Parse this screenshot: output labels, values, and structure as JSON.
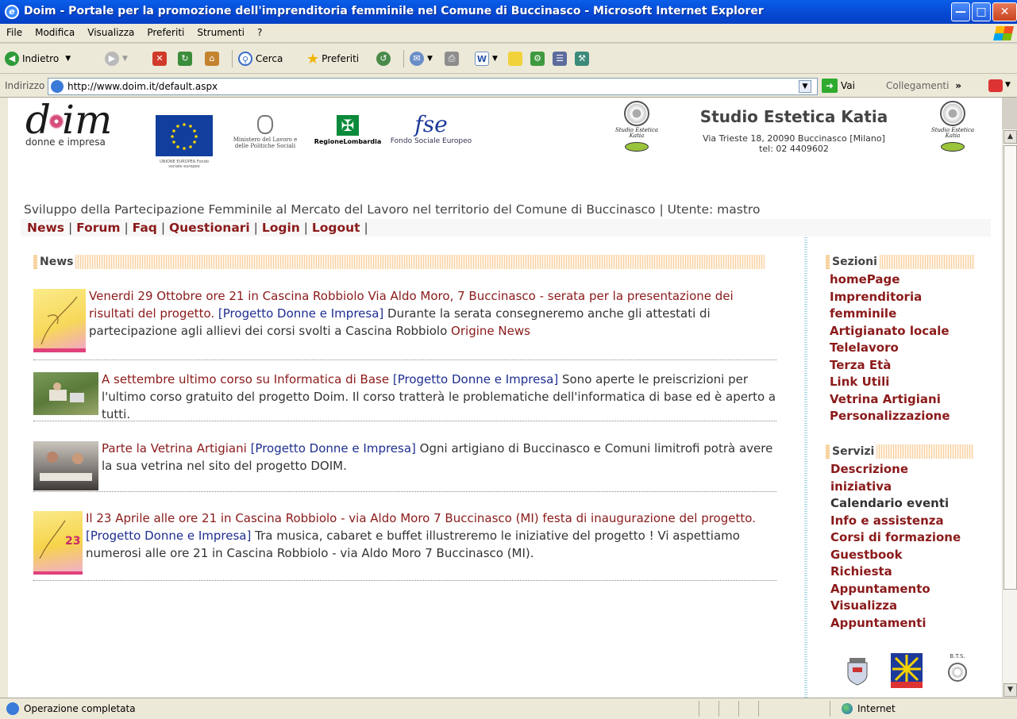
{
  "window": {
    "title": "Doim - Portale per la promozione dell'imprenditoria femminile nel Comune di Buccinasco - Microsoft Internet Explorer"
  },
  "menu": [
    "File",
    "Modifica",
    "Visualizza",
    "Preferiti",
    "Strumenti",
    "?"
  ],
  "toolbar": {
    "back": "Indietro",
    "search": "Cerca",
    "favorites": "Preferiti"
  },
  "address": {
    "label": "Indirizzo",
    "url": "http://www.doim.it/default.aspx",
    "go": "Vai",
    "links": "Collegamenti"
  },
  "header": {
    "logo_subtitle": "donne e impresa",
    "logo_letters": [
      "d",
      "im"
    ],
    "eu_caption": "UNIONE EUROPEA Fondo sociale europeo",
    "ministry": "Ministero del Lavoro e delle Politiche Sociali",
    "region": "RegioneLombardia",
    "fse": "Fondo Sociale Europeo",
    "fse_word": "fse",
    "studio_title": "Studio Estetica Katia",
    "studio_address": "Via Trieste 18, 20090 Buccinasco [Milano]",
    "studio_tel": "tel: 02 4409602",
    "studio_script": "Studio Estetica Katia"
  },
  "tagline": "Sviluppo della Partecipazione Femminile al Mercato del Lavoro nel territorio del Comune di Buccinasco",
  "user": "| Utente: mastro",
  "nav": [
    "News",
    "Forum",
    "Faq",
    "Questionari",
    "Login",
    "Logout"
  ],
  "news_heading": "News",
  "news": [
    {
      "title": "Venerdi 29 Ottobre ore 21 in Cascina Robbiolo Via Aldo Moro, 7 Buccinasco - serata per la presentazione dei risultati del progetto.",
      "tag": "[Progetto Donne e Impresa]",
      "body": "Durante la serata consegneremo anche gli attestati di partecipazione agli allievi dei corsi svolti a Cascina Robbiolo",
      "origin": "Origine News"
    },
    {
      "title": "A settembre ultimo corso su Informatica di Base",
      "tag": "[Progetto Donne e Impresa]",
      "body": "Sono aperte le preiscrizioni per l'ultimo corso gratuito del progetto Doim. Il corso tratterà le problematiche dell'informatica di base ed è aperto a tutti.",
      "origin": ""
    },
    {
      "title": "Parte la Vetrina Artigiani",
      "tag": "[Progetto Donne e Impresa]",
      "body": "Ogni artigiano di Buccinasco e Comuni limitrofi potrà avere la sua vetrina nel sito del progetto DOIM.",
      "origin": ""
    },
    {
      "title": "Il 23 Aprile alle ore 21 in Cascina Robbiolo - via Aldo Moro 7 Buccinasco (MI) festa di inaugurazione del progetto.",
      "tag": "[Progetto Donne e Impresa]",
      "body": "Tra musica, cabaret e buffet illustreremo le iniziative del progetto ! Vi aspettiamo numerosi alle ore 21 in Cascina Robbiolo - via Aldo Moro 7 Buccinasco (MI).",
      "origin": ""
    }
  ],
  "sections_heading": "Sezioni",
  "sections": [
    "homePage",
    "Imprenditoria femminile",
    "Artigianato locale",
    "Telelavoro",
    "Terza Età",
    "Link Utili",
    "Vetrina Artigiani",
    "Personalizzazione"
  ],
  "services_heading": "Servizi",
  "services": [
    "Descrizione iniziativa",
    "Calendario eventi",
    "Info e assistenza",
    "Corsi di formazione",
    "Guestbook",
    "Richiesta Appuntamento",
    "Visualizza Appuntamenti"
  ],
  "bottom_logo_text": "B.T.S.",
  "status": {
    "text": "Operazione completata",
    "zone": "Internet"
  }
}
